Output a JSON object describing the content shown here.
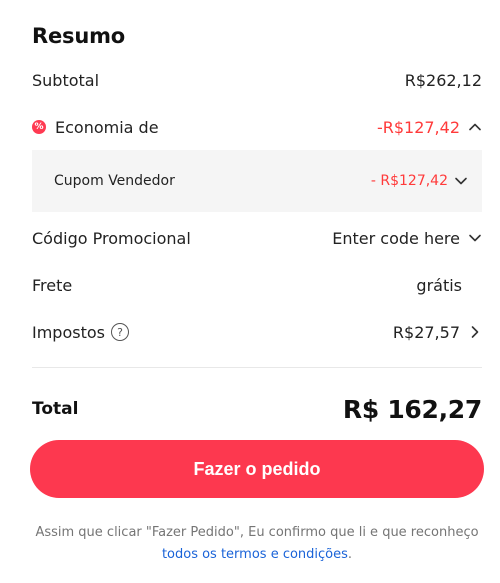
{
  "summary": {
    "title": "Resumo",
    "subtotal_label": "Subtotal",
    "subtotal_value": "R$262,12",
    "savings_label": "Economia de",
    "savings_value": "-R$127,42",
    "seller_coupon_label": "Cupom Vendedor",
    "seller_coupon_value": "- R$127,42",
    "promo_label": "Código Promocional",
    "promo_value": "Enter code here",
    "shipping_label": "Frete",
    "shipping_value": "grátis",
    "taxes_label": "Impostos",
    "taxes_value": "R$27,57",
    "total_label": "Total",
    "total_value": "R$ 162,27"
  },
  "actions": {
    "place_order": "Fazer o pedido"
  },
  "legal": {
    "text": "Assim que clicar \"Fazer Pedido\", Eu confirmo que li e que reconheço ",
    "link": "todos os termos e condições",
    "end": "."
  },
  "colors": {
    "accent": "#fd384f",
    "discount": "#ff3a3a",
    "link": "#1a63d8",
    "panel": "#f5f5f5"
  },
  "icons": {
    "savings": "discount-badge-icon",
    "collapse": "chevron-up-icon",
    "expand": "chevron-down-icon",
    "next": "chevron-right-icon",
    "help": "question-circle-icon"
  }
}
